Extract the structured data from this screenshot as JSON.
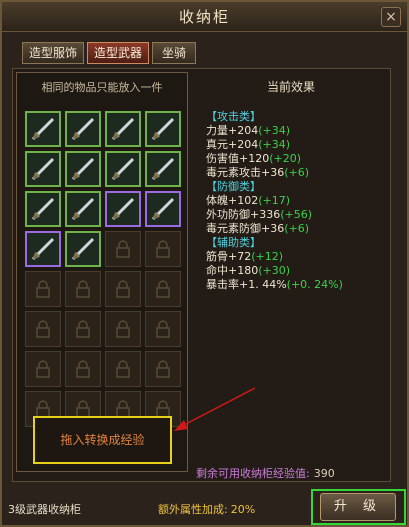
{
  "window": {
    "title": "收纳柜",
    "close_label": "×"
  },
  "tabs": [
    {
      "label": "造型服饰",
      "active": false
    },
    {
      "label": "造型武器",
      "active": true
    },
    {
      "label": "坐骑",
      "active": false
    }
  ],
  "left_panel": {
    "header": "相同的物品只能放入一件",
    "filled_slots": [
      {
        "icon": "weapon-icon"
      },
      {
        "icon": "weapon-icon"
      },
      {
        "icon": "weapon-icon"
      },
      {
        "icon": "weapon-icon"
      },
      {
        "icon": "weapon-icon"
      },
      {
        "icon": "weapon-icon"
      },
      {
        "icon": "weapon-icon"
      },
      {
        "icon": "weapon-icon"
      },
      {
        "icon": "weapon-icon"
      },
      {
        "icon": "weapon-icon"
      },
      {
        "icon": "weapon-icon"
      },
      {
        "icon": "weapon-icon"
      },
      {
        "icon": "weapon-icon"
      },
      {
        "icon": "weapon-icon"
      }
    ],
    "locked_slot_count": 18,
    "convert_label": "拖入转换成经验"
  },
  "right_panel": {
    "header": "当前效果",
    "groups": [
      {
        "category": "【攻击类】",
        "rows": [
          {
            "text": "力量+204",
            "bonus": "(+34)"
          },
          {
            "text": "真元+204",
            "bonus": "(+34)"
          },
          {
            "text": "伤害值+120",
            "bonus": "(+20)"
          },
          {
            "text": "毒元素攻击+36",
            "bonus": "(+6)"
          }
        ]
      },
      {
        "category": "【防御类】",
        "rows": [
          {
            "text": "体魄+102",
            "bonus": "(+17)"
          },
          {
            "text": "外功防御+336",
            "bonus": "(+56)"
          },
          {
            "text": "毒元素防御+36",
            "bonus": "(+6)"
          }
        ]
      },
      {
        "category": "【辅助类】",
        "rows": [
          {
            "text": "筋骨+72",
            "bonus": "(+12)"
          },
          {
            "text": "命中+180",
            "bonus": "(+30)"
          },
          {
            "text": "暴击率+1. 44%",
            "bonus": "(+0. 24%)"
          }
        ]
      }
    ]
  },
  "remaining": {
    "label": "剩余可用收纳柜经验值:",
    "value": "390"
  },
  "footer": {
    "cabinet_level": "3级武器收纳柜",
    "extra_label": "额外属性加成:",
    "extra_value": "20%",
    "upgrade_label": "升 级"
  },
  "colors": {
    "category": "#4fd1e0",
    "bonus": "#39d04a",
    "highlight_box": "#e6d21a",
    "upgrade_outline": "#34d63a"
  }
}
